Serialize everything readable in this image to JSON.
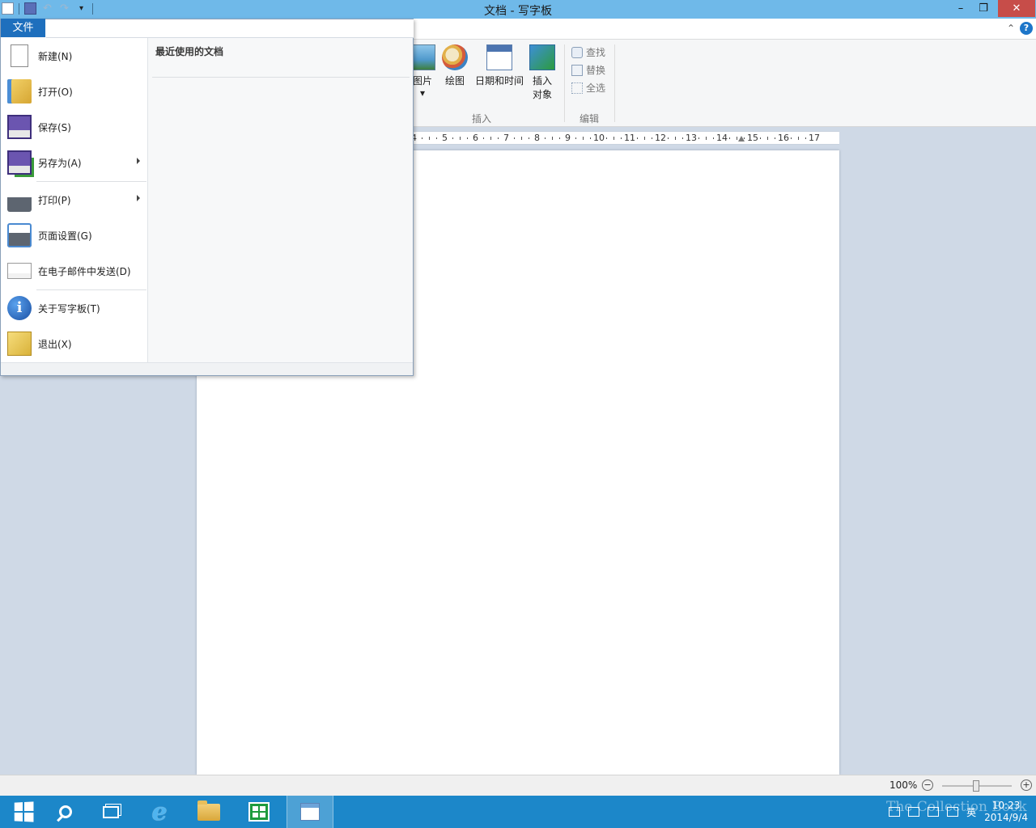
{
  "window": {
    "title": "文档 - 写字板",
    "minimize": "–",
    "maximize": "❐",
    "close": "✕"
  },
  "qat": {
    "undo": "↶",
    "redo": "↷",
    "more": "▾"
  },
  "ribbon": {
    "collapse": "⌃",
    "help": "?",
    "picture": "图片",
    "picture_arrow": "▾",
    "paint": "绘图",
    "datetime": "日期和时间",
    "insert_object_1": "插入",
    "insert_object_2": "对象",
    "group_insert": "插入",
    "find": "查找",
    "replace": "替换",
    "select_all": "全选",
    "group_edit": "编辑"
  },
  "ruler": {
    "ticks": [
      "4",
      "5",
      "6",
      "7",
      "8",
      "9",
      "10",
      "11",
      "12",
      "13",
      "14",
      "15",
      "16",
      "17"
    ]
  },
  "file_menu": {
    "tab_label": "文件",
    "items": [
      {
        "label": "新建(N)"
      },
      {
        "label": "打开(O)"
      },
      {
        "label": "保存(S)"
      },
      {
        "label": "另存为(A)"
      },
      {
        "label": "打印(P)"
      },
      {
        "label": "页面设置(G)"
      },
      {
        "label": "在电子邮件中发送(D)"
      },
      {
        "label": "关于写字板(T)"
      },
      {
        "label": "退出(X)"
      }
    ],
    "recent_title": "最近使用的文档"
  },
  "statusbar": {
    "zoom": "100%",
    "zoom_out": "−",
    "zoom_in": "+"
  },
  "taskbar": {
    "ie": "e",
    "lang": "英",
    "time": "10:23",
    "date": "2014/9/4"
  },
  "watermark": "The Collection Book",
  "colors": {
    "titlebar": "#6fb9e9",
    "file_tab": "#1e6fbd",
    "taskbar": "#1c87c9",
    "close": "#c74d49"
  }
}
